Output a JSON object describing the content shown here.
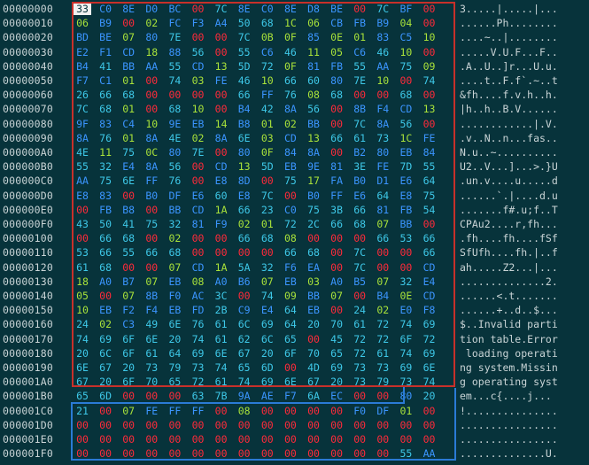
{
  "colors": {
    "background": "#07333b",
    "zero": "#ff2a3a",
    "control": "#a9e23a",
    "text": "#3ec8e8",
    "other": "#3b95ff",
    "offset": "#c9d4d6",
    "selection_red": "#c8302a",
    "selection_blue": "#2a7bd6"
  },
  "rows": [
    {
      "offset": "00000000",
      "bytes": [
        "33",
        "C0",
        "8E",
        "D0",
        "BC",
        "00",
        "7C",
        "8E",
        "C0",
        "8E",
        "D8",
        "BE",
        "00",
        "7C",
        "BF",
        "00"
      ],
      "ascii": "3.....|.....|..."
    },
    {
      "offset": "00000010",
      "bytes": [
        "06",
        "B9",
        "00",
        "02",
        "FC",
        "F3",
        "A4",
        "50",
        "68",
        "1C",
        "06",
        "CB",
        "FB",
        "B9",
        "04",
        "00"
      ],
      "ascii": "......Ph........"
    },
    {
      "offset": "00000020",
      "bytes": [
        "BD",
        "BE",
        "07",
        "80",
        "7E",
        "00",
        "00",
        "7C",
        "0B",
        "0F",
        "85",
        "0E",
        "01",
        "83",
        "C5",
        "10"
      ],
      "ascii": "....~..|........"
    },
    {
      "offset": "00000030",
      "bytes": [
        "E2",
        "F1",
        "CD",
        "18",
        "88",
        "56",
        "00",
        "55",
        "C6",
        "46",
        "11",
        "05",
        "C6",
        "46",
        "10",
        "00"
      ],
      "ascii": ".....V.U.F...F.."
    },
    {
      "offset": "00000040",
      "bytes": [
        "B4",
        "41",
        "BB",
        "AA",
        "55",
        "CD",
        "13",
        "5D",
        "72",
        "0F",
        "81",
        "FB",
        "55",
        "AA",
        "75",
        "09"
      ],
      "ascii": ".A..U..]r...U.u."
    },
    {
      "offset": "00000050",
      "bytes": [
        "F7",
        "C1",
        "01",
        "00",
        "74",
        "03",
        "FE",
        "46",
        "10",
        "66",
        "60",
        "80",
        "7E",
        "10",
        "00",
        "74"
      ],
      "ascii": "....t..F.f`.~..t"
    },
    {
      "offset": "00000060",
      "bytes": [
        "26",
        "66",
        "68",
        "00",
        "00",
        "00",
        "00",
        "66",
        "FF",
        "76",
        "08",
        "68",
        "00",
        "00",
        "68",
        "00"
      ],
      "ascii": "&fh....f.v.h..h."
    },
    {
      "offset": "00000070",
      "bytes": [
        "7C",
        "68",
        "01",
        "00",
        "68",
        "10",
        "00",
        "B4",
        "42",
        "8A",
        "56",
        "00",
        "8B",
        "F4",
        "CD",
        "13"
      ],
      "ascii": "|h..h..B.V......"
    },
    {
      "offset": "00000080",
      "bytes": [
        "9F",
        "83",
        "C4",
        "10",
        "9E",
        "EB",
        "14",
        "B8",
        "01",
        "02",
        "BB",
        "00",
        "7C",
        "8A",
        "56",
        "00"
      ],
      "ascii": "............|.V."
    },
    {
      "offset": "00000090",
      "bytes": [
        "8A",
        "76",
        "01",
        "8A",
        "4E",
        "02",
        "8A",
        "6E",
        "03",
        "CD",
        "13",
        "66",
        "61",
        "73",
        "1C",
        "FE"
      ],
      "ascii": ".v..N..n...fas.."
    },
    {
      "offset": "000000A0",
      "bytes": [
        "4E",
        "11",
        "75",
        "0C",
        "80",
        "7E",
        "00",
        "80",
        "0F",
        "84",
        "8A",
        "00",
        "B2",
        "80",
        "EB",
        "84"
      ],
      "ascii": "N.u..~.........."
    },
    {
      "offset": "000000B0",
      "bytes": [
        "55",
        "32",
        "E4",
        "8A",
        "56",
        "00",
        "CD",
        "13",
        "5D",
        "EB",
        "9E",
        "81",
        "3E",
        "FE",
        "7D",
        "55"
      ],
      "ascii": "U2..V...]...>.}U"
    },
    {
      "offset": "000000C0",
      "bytes": [
        "AA",
        "75",
        "6E",
        "FF",
        "76",
        "00",
        "E8",
        "8D",
        "00",
        "75",
        "17",
        "FA",
        "B0",
        "D1",
        "E6",
        "64"
      ],
      "ascii": ".un.v....u.....d"
    },
    {
      "offset": "000000D0",
      "bytes": [
        "E8",
        "83",
        "00",
        "B0",
        "DF",
        "E6",
        "60",
        "E8",
        "7C",
        "00",
        "B0",
        "FF",
        "E6",
        "64",
        "E8",
        "75"
      ],
      "ascii": "......`.|....d.u"
    },
    {
      "offset": "000000E0",
      "bytes": [
        "00",
        "FB",
        "B8",
        "00",
        "BB",
        "CD",
        "1A",
        "66",
        "23",
        "C0",
        "75",
        "3B",
        "66",
        "81",
        "FB",
        "54"
      ],
      "ascii": ".......f#.u;f..T"
    },
    {
      "offset": "000000F0",
      "bytes": [
        "43",
        "50",
        "41",
        "75",
        "32",
        "81",
        "F9",
        "02",
        "01",
        "72",
        "2C",
        "66",
        "68",
        "07",
        "BB",
        "00"
      ],
      "ascii": "CPAu2....r,fh..."
    },
    {
      "offset": "00000100",
      "bytes": [
        "00",
        "66",
        "68",
        "00",
        "02",
        "00",
        "00",
        "66",
        "68",
        "08",
        "00",
        "00",
        "00",
        "66",
        "53",
        "66"
      ],
      "ascii": ".fh....fh....fSf"
    },
    {
      "offset": "00000110",
      "bytes": [
        "53",
        "66",
        "55",
        "66",
        "68",
        "00",
        "00",
        "00",
        "00",
        "66",
        "68",
        "00",
        "7C",
        "00",
        "00",
        "66"
      ],
      "ascii": "SfUfh....fh.|..f"
    },
    {
      "offset": "00000120",
      "bytes": [
        "61",
        "68",
        "00",
        "00",
        "07",
        "CD",
        "1A",
        "5A",
        "32",
        "F6",
        "EA",
        "00",
        "7C",
        "00",
        "00",
        "CD"
      ],
      "ascii": "ah.....Z2...|..."
    },
    {
      "offset": "00000130",
      "bytes": [
        "18",
        "A0",
        "B7",
        "07",
        "EB",
        "08",
        "A0",
        "B6",
        "07",
        "EB",
        "03",
        "A0",
        "B5",
        "07",
        "32",
        "E4"
      ],
      "ascii": "..............2."
    },
    {
      "offset": "00000140",
      "bytes": [
        "05",
        "00",
        "07",
        "8B",
        "F0",
        "AC",
        "3C",
        "00",
        "74",
        "09",
        "BB",
        "07",
        "00",
        "B4",
        "0E",
        "CD"
      ],
      "ascii": "......<.t......."
    },
    {
      "offset": "00000150",
      "bytes": [
        "10",
        "EB",
        "F2",
        "F4",
        "EB",
        "FD",
        "2B",
        "C9",
        "E4",
        "64",
        "EB",
        "00",
        "24",
        "02",
        "E0",
        "F8"
      ],
      "ascii": "......+..d..$..."
    },
    {
      "offset": "00000160",
      "bytes": [
        "24",
        "02",
        "C3",
        "49",
        "6E",
        "76",
        "61",
        "6C",
        "69",
        "64",
        "20",
        "70",
        "61",
        "72",
        "74",
        "69"
      ],
      "ascii": "$..Invalid parti"
    },
    {
      "offset": "00000170",
      "bytes": [
        "74",
        "69",
        "6F",
        "6E",
        "20",
        "74",
        "61",
        "62",
        "6C",
        "65",
        "00",
        "45",
        "72",
        "72",
        "6F",
        "72"
      ],
      "ascii": "tion table.Error"
    },
    {
      "offset": "00000180",
      "bytes": [
        "20",
        "6C",
        "6F",
        "61",
        "64",
        "69",
        "6E",
        "67",
        "20",
        "6F",
        "70",
        "65",
        "72",
        "61",
        "74",
        "69"
      ],
      "ascii": " loading operati"
    },
    {
      "offset": "00000190",
      "bytes": [
        "6E",
        "67",
        "20",
        "73",
        "79",
        "73",
        "74",
        "65",
        "6D",
        "00",
        "4D",
        "69",
        "73",
        "73",
        "69",
        "6E"
      ],
      "ascii": "ng system.Missin"
    },
    {
      "offset": "000001A0",
      "bytes": [
        "67",
        "20",
        "6F",
        "70",
        "65",
        "72",
        "61",
        "74",
        "69",
        "6E",
        "67",
        "20",
        "73",
        "79",
        "73",
        "74"
      ],
      "ascii": "g operating syst"
    },
    {
      "offset": "000001B0",
      "bytes": [
        "65",
        "6D",
        "00",
        "00",
        "00",
        "63",
        "7B",
        "9A",
        "AE",
        "F7",
        "6A",
        "EC",
        "00",
        "00",
        "80",
        "20"
      ],
      "ascii": "em...c{....j... "
    },
    {
      "offset": "000001C0",
      "bytes": [
        "21",
        "00",
        "07",
        "FE",
        "FF",
        "FF",
        "00",
        "08",
        "00",
        "00",
        "00",
        "00",
        "F0",
        "DF",
        "01",
        "00"
      ],
      "ascii": "!..............."
    },
    {
      "offset": "000001D0",
      "bytes": [
        "00",
        "00",
        "00",
        "00",
        "00",
        "00",
        "00",
        "00",
        "00",
        "00",
        "00",
        "00",
        "00",
        "00",
        "00",
        "00"
      ],
      "ascii": "................"
    },
    {
      "offset": "000001E0",
      "bytes": [
        "00",
        "00",
        "00",
        "00",
        "00",
        "00",
        "00",
        "00",
        "00",
        "00",
        "00",
        "00",
        "00",
        "00",
        "00",
        "00"
      ],
      "ascii": "................"
    },
    {
      "offset": "000001F0",
      "bytes": [
        "00",
        "00",
        "00",
        "00",
        "00",
        "00",
        "00",
        "00",
        "00",
        "00",
        "00",
        "00",
        "00",
        "00",
        "55",
        "AA"
      ],
      "ascii": "..............U."
    }
  ]
}
